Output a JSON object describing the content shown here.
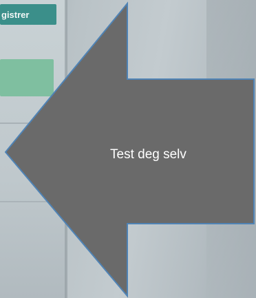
{
  "background_screen": {
    "register_button_label": "gistrer"
  },
  "arrow": {
    "label": "Test deg selv",
    "fill_color": "#6a6a6a",
    "stroke_color": "#4f83b5"
  }
}
